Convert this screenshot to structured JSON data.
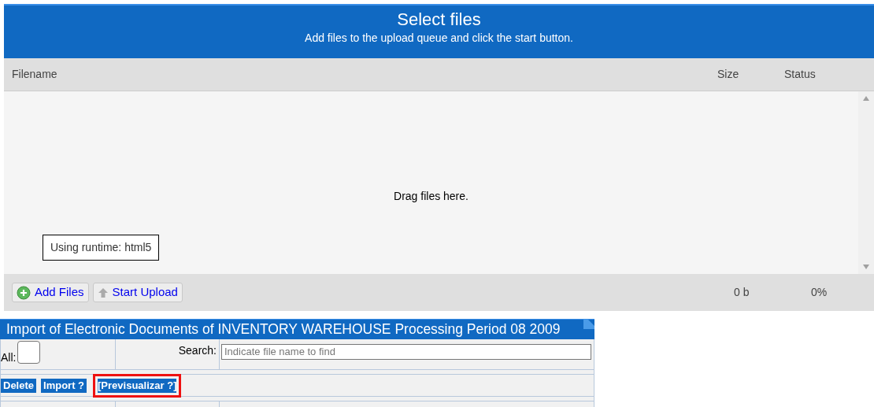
{
  "uploader": {
    "title": "Select files",
    "subtitle": "Add files to the upload queue and click the start button.",
    "columns": [
      "Filename",
      "Size",
      "Status"
    ],
    "drop_hint": "Drag files here.",
    "runtime": "Using runtime: html5",
    "buttons": [
      {
        "label": "Add Files",
        "kind": "add"
      },
      {
        "label": "Start Upload",
        "kind": "upload"
      }
    ],
    "total_size": "0 b",
    "total_percent": "0%"
  },
  "import_panel": {
    "title": "Import of Electronic Documents of INVENTORY WAREHOUSE Processing Period 08 2009",
    "all_label": "All:",
    "all_checked": false,
    "search_label": "Search:",
    "search_placeholder": "Indicate file name to find",
    "actions": [
      {
        "label": "Delete",
        "highlighted": false
      },
      {
        "label": "Import ?",
        "highlighted": false
      },
      {
        "label": "[Previsualizar ?]",
        "highlighted": true
      }
    ]
  }
}
